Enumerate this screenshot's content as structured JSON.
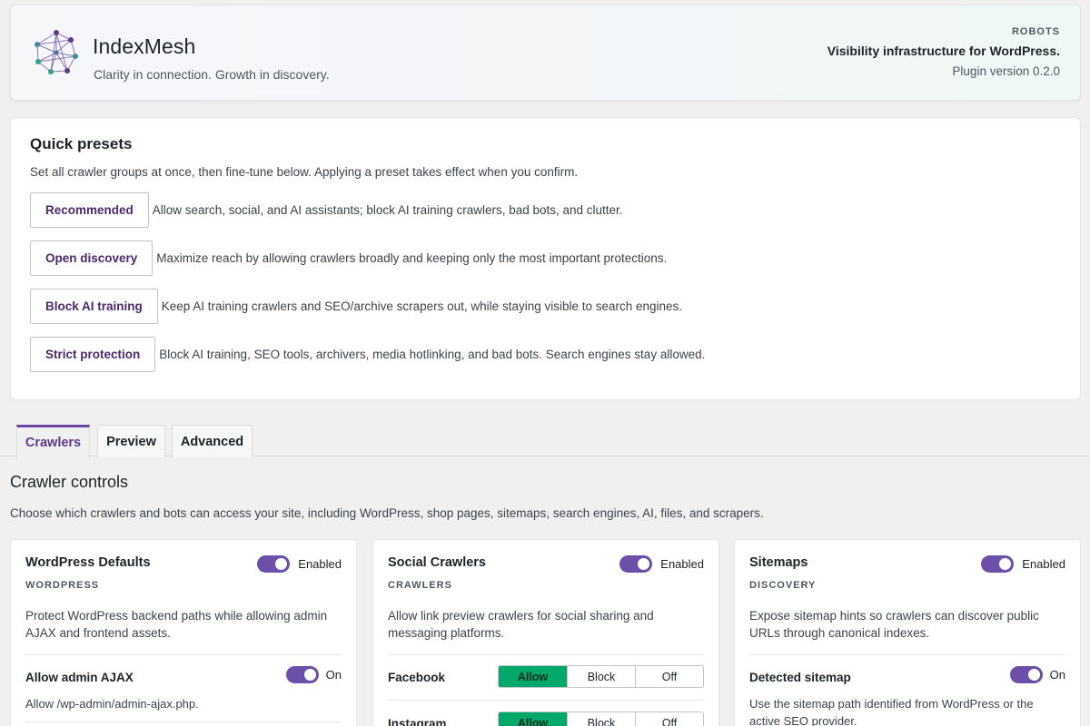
{
  "header": {
    "brand": "IndexMesh",
    "tagline": "Clarity in connection. Growth in discovery.",
    "kicker": "ROBOTS",
    "title": "Visibility infrastructure for WordPress.",
    "version": "Plugin version 0.2.0",
    "logo_icon": "network-mesh-icon"
  },
  "presets": {
    "title": "Quick presets",
    "description": "Set all crawler groups at once, then fine-tune below. Applying a preset takes effect when you confirm.",
    "items": [
      {
        "label": "Recommended",
        "text": "Allow search, social, and AI assistants; block AI training crawlers, bad bots, and clutter."
      },
      {
        "label": "Open discovery",
        "text": "Maximize reach by allowing crawlers broadly and keeping only the most important protections."
      },
      {
        "label": "Block AI training",
        "text": "Keep AI training crawlers and SEO/archive scrapers out, while staying visible to search engines."
      },
      {
        "label": "Strict protection",
        "text": "Block AI training, SEO tools, archivers, media hotlinking, and bad bots. Search engines stay allowed."
      }
    ]
  },
  "tabs": [
    {
      "label": "Crawlers",
      "active": true
    },
    {
      "label": "Preview",
      "active": false
    },
    {
      "label": "Advanced",
      "active": false
    }
  ],
  "section": {
    "title": "Crawler controls",
    "description": "Choose which crawlers and bots can access your site, including WordPress, shop pages, sitemaps, search engines, AI, files, and scrapers."
  },
  "cards": [
    {
      "title": "WordPress Defaults",
      "kicker": "WORDPRESS",
      "toggle": "Enabled",
      "description": "Protect WordPress backend paths while allowing admin AJAX and frontend assets.",
      "rows": [
        {
          "label": "Allow admin AJAX",
          "toggle": "On",
          "description": "Allow /wp-admin/admin-ajax.php."
        }
      ]
    },
    {
      "title": "Social Crawlers",
      "kicker": "CRAWLERS",
      "toggle": "Enabled",
      "description": "Allow link preview crawlers for social sharing and messaging platforms.",
      "rows": [
        {
          "label": "Facebook",
          "options": [
            "Allow",
            "Block",
            "Off"
          ],
          "selected": "Allow"
        },
        {
          "label": "Instagram",
          "options": [
            "Allow",
            "Block",
            "Off"
          ],
          "selected": "Allow"
        }
      ]
    },
    {
      "title": "Sitemaps",
      "kicker": "DISCOVERY",
      "toggle": "Enabled",
      "description": "Expose sitemap hints so crawlers can discover public URLs through canonical indexes.",
      "rows": [
        {
          "label": "Detected sitemap",
          "toggle": "On",
          "description": "Use the sitemap path identified from WordPress or the active SEO provider."
        }
      ]
    }
  ],
  "colors": {
    "accent": "#6b4fa8",
    "allow": "#00a86b",
    "preset_text": "#4b2a6b"
  }
}
